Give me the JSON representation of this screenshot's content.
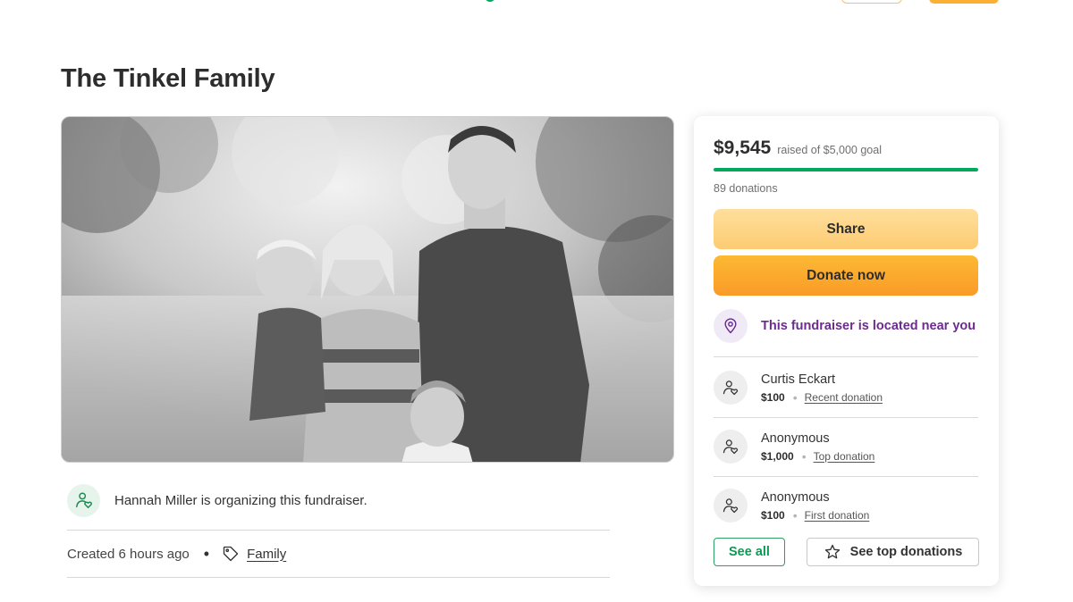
{
  "page": {
    "title": "The Tinkel Family"
  },
  "organizer": {
    "text": "Hannah Miller is organizing this fundraiser.",
    "icon": "user-heart-icon"
  },
  "meta": {
    "created": "Created 6 hours ago",
    "separator": "•",
    "category": "Family",
    "category_icon": "tag-icon"
  },
  "donation_card": {
    "raised": "$9,545",
    "goal_text": "raised of $5,000 goal",
    "progress_fraction": 1.0,
    "donation_count": "89 donations",
    "share_label": "Share",
    "donate_label": "Donate now",
    "location_text": "This fundraiser is located near you",
    "location_icon": "map-pin-icon",
    "donors": [
      {
        "name": "Curtis Eckart",
        "amount": "$100",
        "type": "Recent donation"
      },
      {
        "name": "Anonymous",
        "amount": "$1,000",
        "type": "Top donation"
      },
      {
        "name": "Anonymous",
        "amount": "$100",
        "type": "First donation"
      }
    ],
    "bullet": "•",
    "see_all_label": "See all",
    "see_top_label": "See top donations"
  },
  "colors": {
    "brand_green": "#02a95c",
    "donate_orange": "#f99b27",
    "share_yellow": "#fdcb72",
    "location_purple": "#6b2b8f"
  }
}
